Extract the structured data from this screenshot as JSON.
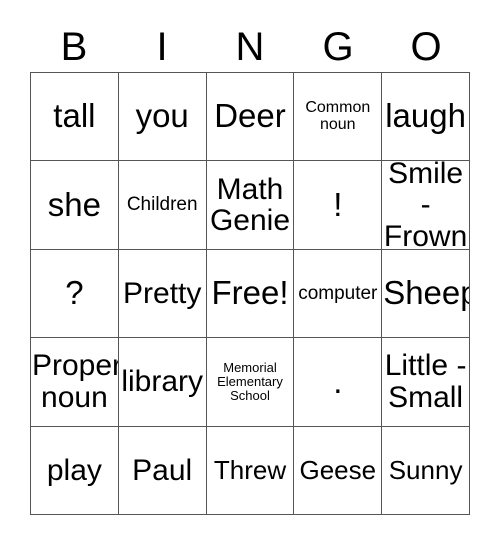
{
  "card": {
    "title": "BINGO",
    "header_letters": [
      "B",
      "I",
      "N",
      "G",
      "O"
    ],
    "columns": 5,
    "rows": 5,
    "border_color": "#555555",
    "text_color": "#000000",
    "background_color": "#ffffff",
    "free_space": {
      "row": 2,
      "column": 2,
      "label": "Free!"
    },
    "cells": [
      [
        {
          "text": "tall",
          "size": "fs-xxl"
        },
        {
          "text": "you",
          "size": "fs-xxl"
        },
        {
          "text": "Deer",
          "size": "fs-xxl"
        },
        {
          "text": "Common\nnoun",
          "size": "fs-sm"
        },
        {
          "text": "laugh",
          "size": "fs-xxl"
        }
      ],
      [
        {
          "text": "she",
          "size": "fs-xxl"
        },
        {
          "text": "Children",
          "size": "fs-md"
        },
        {
          "text": "Math\nGenie",
          "size": "fs-xl"
        },
        {
          "text": "!",
          "size": "fs-dot"
        },
        {
          "text": "Smile -\nFrown",
          "size": "fs-xl"
        }
      ],
      [
        {
          "text": "?",
          "size": "fs-xxl"
        },
        {
          "text": "Pretty",
          "size": "fs-xl"
        },
        {
          "text": "Free!",
          "size": "fs-xxl"
        },
        {
          "text": "computer",
          "size": "fs-md"
        },
        {
          "text": "Sheep",
          "size": "fs-xxl"
        }
      ],
      [
        {
          "text": "Proper\nnoun",
          "size": "fs-xl"
        },
        {
          "text": "library",
          "size": "fs-xl"
        },
        {
          "text": "Memorial\nElementary\nSchool",
          "size": "fs-xs"
        },
        {
          "text": ".",
          "size": "fs-dot"
        },
        {
          "text": "Little -\nSmall",
          "size": "fs-xl"
        }
      ],
      [
        {
          "text": "play",
          "size": "fs-xl"
        },
        {
          "text": "Paul",
          "size": "fs-xl"
        },
        {
          "text": "Threw",
          "size": "fs-lg"
        },
        {
          "text": "Geese",
          "size": "fs-lg"
        },
        {
          "text": "Sunny",
          "size": "fs-lg"
        }
      ]
    ]
  }
}
